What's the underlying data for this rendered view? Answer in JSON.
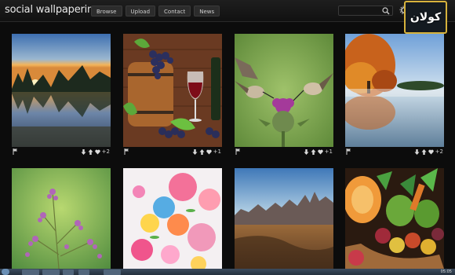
{
  "header": {
    "logo": "social wallpapering",
    "nav": [
      "Browse",
      "Upload",
      "Contact",
      "News"
    ],
    "search_placeholder": "",
    "badge_text": "كولان"
  },
  "tiles": [
    {
      "votes": "+2"
    },
    {
      "votes": "+1"
    },
    {
      "votes": "+1"
    },
    {
      "votes": "+2"
    },
    {
      "votes": ""
    },
    {
      "votes": ""
    },
    {
      "votes": ""
    },
    {
      "votes": ""
    }
  ],
  "taskbar": {
    "clock": "05:05"
  },
  "colors": {
    "accent": "#d6b23c",
    "background": "#0c0c0c"
  }
}
